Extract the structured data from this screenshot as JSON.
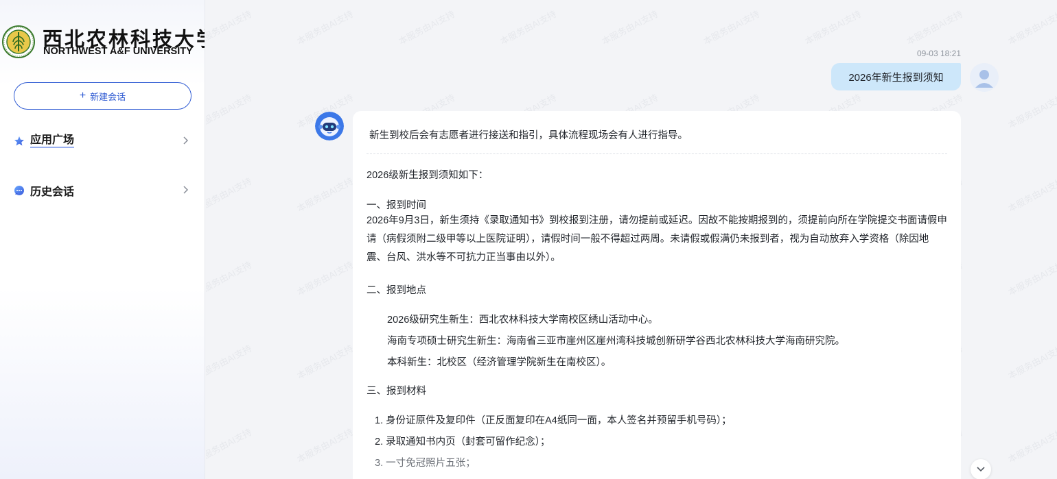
{
  "sidebar": {
    "logo": {
      "cn": "西北农林科技大学",
      "en": "NORTHWEST A&F UNIVERSITY",
      "icon": "university-seal"
    },
    "new_chat_label": "新建会话",
    "items": [
      {
        "label": "应用广场",
        "icon": "star-icon"
      },
      {
        "label": "历史会话",
        "icon": "chat-bubble-icon"
      }
    ]
  },
  "watermark_text": "本服务由AI支持",
  "conversation": {
    "timestamp": "09-03 18:21",
    "user_message": "2026年新生报到须知",
    "answer": {
      "summary": "新生到校后会有志愿者进行接送和指引，具体流程现场会有人进行指导。",
      "intro": "2026级新生报到须知如下：",
      "section1_title": "一、报到时间",
      "section1_text": "2026年9月3日，新生须持《录取通知书》到校报到注册，请勿提前或延迟。因故不能按期报到的，须提前向所在学院提交书面请假申请（病假须附二级甲等以上医院证明），请假时间一般不得超过两周。未请假或假满仍未报到者，视为自动放弃入学资格（除因地震、台风、洪水等不可抗力正当事由以外）。",
      "section2_title": "二、报到地点",
      "section2_items": [
        "2026级研究生新生：西北农林科技大学南校区绣山活动中心。",
        "海南专项硕士研究生新生：海南省三亚市崖州区崖州湾科技城创新研学谷西北农林科技大学海南研究院。",
        "本科新生：北校区（经济管理学院新生在南校区）。"
      ],
      "section3_title": "三、报到材料",
      "section3_items": [
        "1. 身份证原件及复印件（正反面复印在A4纸同一面，本人签名并预留手机号码）；",
        "2. 录取通知书内页（封套可留作纪念）；",
        "3. 一寸免冠照片五张；"
      ]
    }
  },
  "colors": {
    "accent": "#2f5bd3",
    "user_bubble": "#cde7fa"
  }
}
